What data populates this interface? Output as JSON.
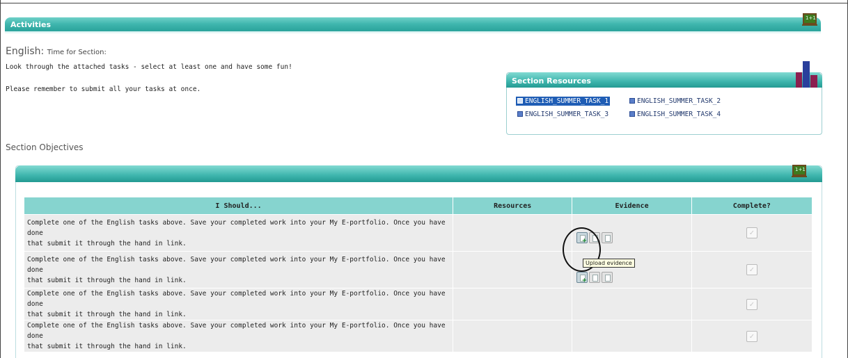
{
  "activities": {
    "title": "Activities"
  },
  "section": {
    "subject": "English:",
    "time_label": "Time for Section:",
    "instruction_1": "Look through the attached tasks - select at least one and have some fun!",
    "instruction_2": "Please remember to submit all your tasks at once."
  },
  "resources": {
    "title": "Section Resources",
    "items": [
      {
        "label": "ENGLISH_SUMMER_TASK_1",
        "selected": true
      },
      {
        "label": "ENGLISH_SUMMER_TASK_2",
        "selected": false
      },
      {
        "label": "ENGLISH_SUMMER_TASK_3",
        "selected": false
      },
      {
        "label": "ENGLISH_SUMMER_TASK_4",
        "selected": false
      }
    ]
  },
  "objectives": {
    "heading": "Section Objectives",
    "board_label": "1+1",
    "columns": [
      "I Should...",
      "Resources",
      "Evidence",
      "Complete?"
    ],
    "rows": [
      {
        "desc_line1": "Complete one of the English tasks above. Save your completed work into your My E-portfolio. Once you have done",
        "desc_line2": "that submit it through the hand in link."
      },
      {
        "desc_line1": "Complete one of the English tasks above. Save your completed work into your My E-portfolio. Once you have done",
        "desc_line2": "that submit it through the hand in link."
      },
      {
        "desc_line1": "Complete one of the English tasks above. Save your completed work into your My E-portfolio. Once you have done",
        "desc_line2": "that submit it through the hand in link."
      },
      {
        "desc_line1": "Complete one of the English tasks above. Save your completed work into your My E-portfolio. Once you have done",
        "desc_line2": "that submit it through the hand in link."
      }
    ],
    "tooltip": "Upload evidence"
  },
  "icons": {
    "board": "chalkboard-icon",
    "bars": "bar-chart-icon",
    "upload": "upload-evidence-icon",
    "link": "link-evidence-icon",
    "remove": "remove-evidence-icon",
    "checkbox": "complete-checkbox"
  },
  "colors": {
    "teal": "#3eb5ad",
    "header_teal": "#86d4cf",
    "selected_blue": "#1f5db5"
  }
}
